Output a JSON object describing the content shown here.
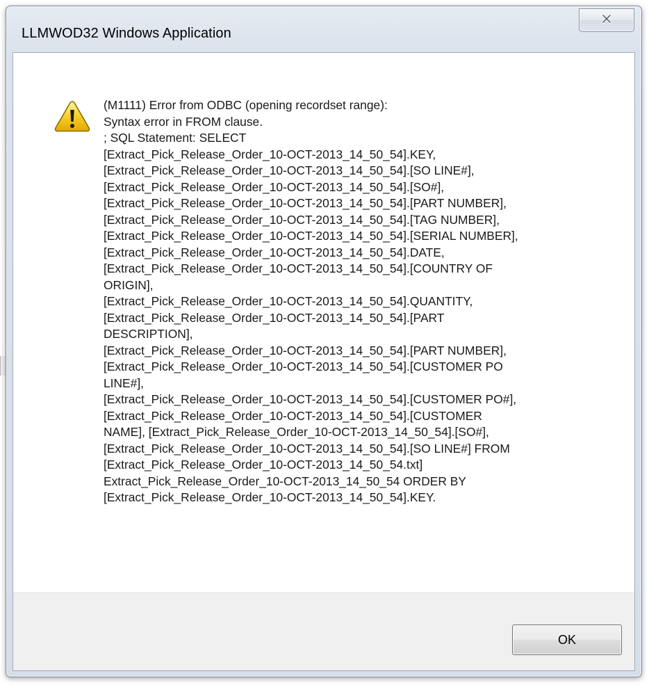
{
  "window": {
    "title": "LLMWOD32 Windows Application"
  },
  "icons": {
    "warning": "warning-triangle-icon",
    "close": "close-x-icon"
  },
  "message": {
    "text": "(M1111) Error from ODBC (opening recordset range):\nSyntax error in FROM clause.\n; SQL Statement: SELECT\n[Extract_Pick_Release_Order_10-OCT-2013_14_50_54].KEY,\n[Extract_Pick_Release_Order_10-OCT-2013_14_50_54].[SO LINE#],\n[Extract_Pick_Release_Order_10-OCT-2013_14_50_54].[SO#],\n[Extract_Pick_Release_Order_10-OCT-2013_14_50_54].[PART NUMBER],\n[Extract_Pick_Release_Order_10-OCT-2013_14_50_54].[TAG NUMBER],\n[Extract_Pick_Release_Order_10-OCT-2013_14_50_54].[SERIAL NUMBER],\n[Extract_Pick_Release_Order_10-OCT-2013_14_50_54].DATE,\n[Extract_Pick_Release_Order_10-OCT-2013_14_50_54].[COUNTRY OF\nORIGIN],\n[Extract_Pick_Release_Order_10-OCT-2013_14_50_54].QUANTITY,\n[Extract_Pick_Release_Order_10-OCT-2013_14_50_54].[PART\nDESCRIPTION],\n[Extract_Pick_Release_Order_10-OCT-2013_14_50_54].[PART NUMBER],\n[Extract_Pick_Release_Order_10-OCT-2013_14_50_54].[CUSTOMER PO\nLINE#],\n[Extract_Pick_Release_Order_10-OCT-2013_14_50_54].[CUSTOMER PO#],\n[Extract_Pick_Release_Order_10-OCT-2013_14_50_54].[CUSTOMER\nNAME], [Extract_Pick_Release_Order_10-OCT-2013_14_50_54].[SO#],\n[Extract_Pick_Release_Order_10-OCT-2013_14_50_54].[SO LINE#] FROM\n[Extract_Pick_Release_Order_10-OCT-2013_14_50_54.txt]\nExtract_Pick_Release_Order_10-OCT-2013_14_50_54 ORDER BY\n[Extract_Pick_Release_Order_10-OCT-2013_14_50_54].KEY."
  },
  "buttons": {
    "ok_label": "OK"
  },
  "colors": {
    "title_bar": "#dbe3ec",
    "button_bar": "#f0f0f0",
    "warning_fill": "#f5c518",
    "warning_border": "#8a6d00"
  }
}
